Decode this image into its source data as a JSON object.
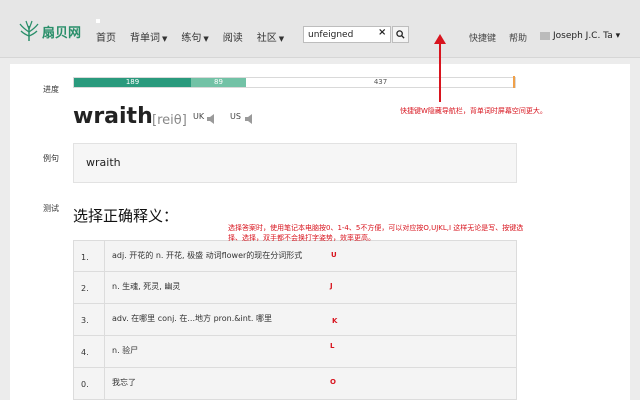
{
  "header": {
    "logo_text": "扇贝网",
    "nav": [
      {
        "label": "首页",
        "has_caret": false
      },
      {
        "label": "背单词",
        "has_caret": true
      },
      {
        "label": "练句",
        "has_caret": true
      },
      {
        "label": "阅读",
        "has_caret": false
      },
      {
        "label": "社区",
        "has_caret": true
      }
    ],
    "search": {
      "value": "unfeigned",
      "clear_glyph": "×",
      "icon": "search-icon"
    },
    "shortcut": "快捷键",
    "help": "帮助",
    "user": "Joseph J.C. Ta",
    "user_caret": "▾"
  },
  "annotations": {
    "nav_note": "快捷键W隐藏导航栏，背单词时屏幕空间更大。",
    "choice_note": "选择答案时，使用笔记本电脑按0、1-4、5不方便，可以对应按O,UJKL,I 这样无论是写、按键选择、选择，双手都不会换打字姿势，效率更高。",
    "color": "#d8141e"
  },
  "labels": {
    "progress": "进度",
    "example": "例句",
    "test": "测试"
  },
  "progress": {
    "learned": "189",
    "review": "89",
    "remaining": "437",
    "learned_fraction": 0.265,
    "review_fraction": 0.125
  },
  "word": {
    "text": "wraith",
    "pronunciation": "[reiθ]",
    "uk": "UK",
    "us": "US"
  },
  "example": "wraith",
  "question": "选择正确释义：",
  "choices": [
    {
      "num": "1.",
      "text": "adj. 开花的 n. 开花, 极盛 动词flower的现在分词形式",
      "key": "U"
    },
    {
      "num": "2.",
      "text": "n. 生魂, 死灵, 幽灵",
      "key": "J"
    },
    {
      "num": "3.",
      "text": "adv. 在哪里 conj. 在...地方 pron.&int. 哪里",
      "key": "K"
    },
    {
      "num": "4.",
      "text": "n. 验尸",
      "key": "L"
    },
    {
      "num": "0.",
      "text": "我忘了",
      "key": "O"
    }
  ],
  "colors": {
    "accent": "#2a9a7d",
    "accent_light": "#72c2a6",
    "annotation": "#d8141e"
  }
}
